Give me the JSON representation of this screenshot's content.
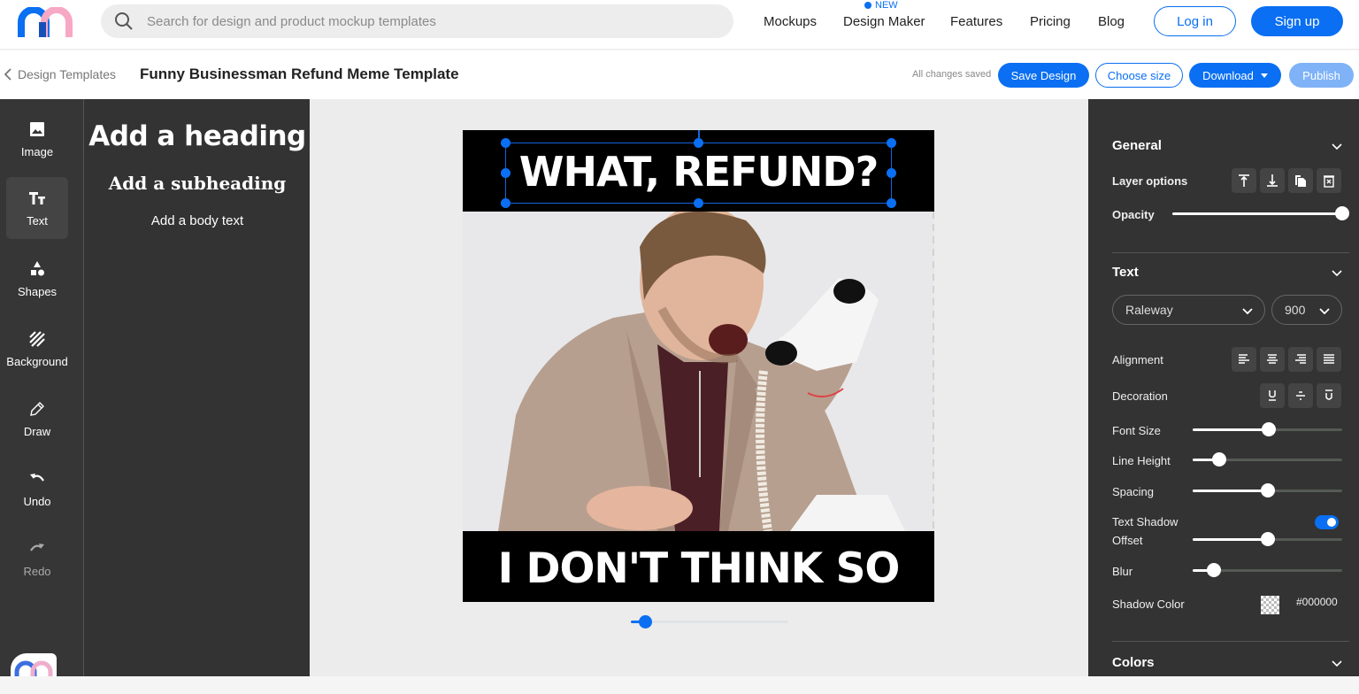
{
  "topnav": {
    "search_placeholder": "Search for design and product mockup templates",
    "links": [
      "Mockups",
      "Design Maker",
      "Features",
      "Pricing",
      "Blog"
    ],
    "new_badge": "NEW",
    "login": "Log in",
    "signup": "Sign up"
  },
  "subbar": {
    "back_label": "Design Templates",
    "title": "Funny Businessman Refund Meme Template",
    "status": "All changes saved",
    "save": "Save Design",
    "choose_size": "Choose size",
    "download": "Download",
    "publish": "Publish"
  },
  "rail": {
    "items": [
      {
        "label": "Image",
        "icon": "image-icon"
      },
      {
        "label": "Text",
        "icon": "text-icon",
        "active": true
      },
      {
        "label": "Shapes",
        "icon": "shapes-icon"
      },
      {
        "label": "Background",
        "icon": "background-icon"
      },
      {
        "label": "Draw",
        "icon": "pencil-icon"
      },
      {
        "label": "Undo",
        "icon": "undo-icon"
      },
      {
        "label": "Redo",
        "icon": "redo-icon",
        "disabled": true
      }
    ]
  },
  "text_panel": {
    "heading": "Add a heading",
    "subheading": "Add a subheading",
    "body": "Add a body text"
  },
  "canvas": {
    "top_text": "WHAT, REFUND?",
    "bottom_text": "I DON'T THINK SO",
    "zoom_value": 0.09
  },
  "props": {
    "general": {
      "title": "General",
      "layer_options": "Layer options",
      "opacity_label": "Opacity",
      "opacity": 1.0
    },
    "text": {
      "title": "Text",
      "font": "Raleway",
      "weight": "900",
      "alignment_label": "Alignment",
      "decoration_label": "Decoration",
      "font_size_label": "Font Size",
      "font_size": 0.51,
      "line_height_label": "Line Height",
      "line_height": 0.18,
      "spacing_label": "Spacing",
      "spacing": 0.5,
      "shadow_label": "Text Shadow",
      "shadow_enabled": true,
      "offset_label": "Offset",
      "offset": 0.5,
      "blur_label": "Blur",
      "blur": 0.14,
      "shadow_color_label": "Shadow Color",
      "shadow_color": "#000000"
    },
    "colors": {
      "title": "Colors"
    }
  },
  "colors": {
    "accent": "#0a6ff2",
    "panel": "#333333",
    "logo_blue": "#0a6ff2",
    "logo_pink": "#f7a8c4"
  }
}
